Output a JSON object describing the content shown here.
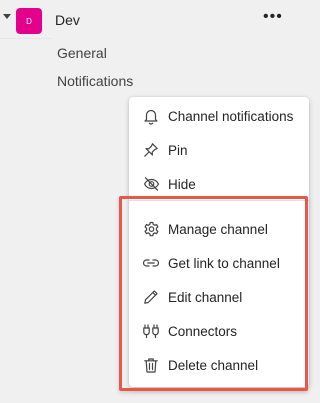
{
  "team": {
    "avatar_initial": "D",
    "name": "Dev",
    "avatar_color": "#e3008c",
    "more_label": "•••"
  },
  "channels": [
    {
      "label": "General"
    },
    {
      "label": "Notifications"
    }
  ],
  "context_menu": {
    "items": [
      {
        "label": "Channel notifications",
        "icon": "bell-icon"
      },
      {
        "label": "Pin",
        "icon": "pin-icon"
      },
      {
        "label": "Hide",
        "icon": "eye-off-icon"
      },
      {
        "label": "Manage channel",
        "icon": "gear-icon"
      },
      {
        "label": "Get link to channel",
        "icon": "link-icon"
      },
      {
        "label": "Edit channel",
        "icon": "pencil-icon"
      },
      {
        "label": "Connectors",
        "icon": "connectors-icon"
      },
      {
        "label": "Delete channel",
        "icon": "trash-icon"
      }
    ]
  },
  "annotation": {
    "highlight_color": "#e8574a"
  }
}
